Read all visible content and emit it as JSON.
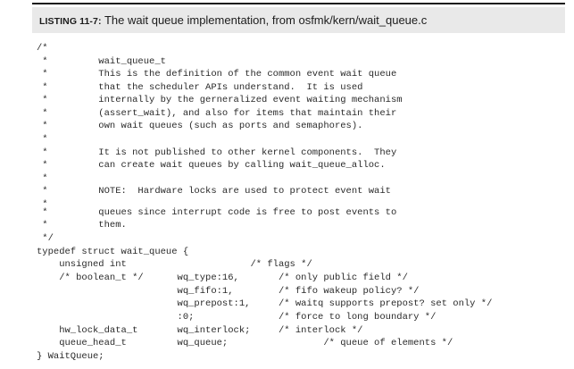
{
  "listing": {
    "label": "LISTING 11-7:",
    "title": "The wait queue implementation, from osfmk/kern/wait_queue.c"
  },
  "code_lines": [
    "/*",
    " *         wait_queue_t",
    " *         This is the definition of the common event wait queue",
    " *         that the scheduler APIs understand.  It is used",
    " *         internally by the gerneralized event waiting mechanism",
    " *         (assert_wait), and also for items that maintain their",
    " *         own wait queues (such as ports and semaphores).",
    " *",
    " *         It is not published to other kernel components.  They",
    " *         can create wait queues by calling wait_queue_alloc.",
    " *",
    " *         NOTE:  Hardware locks are used to protect event wait",
    " *",
    " *         queues since interrupt code is free to post events to",
    " *         them.",
    " */",
    "typedef struct wait_queue {",
    "    unsigned int                      /* flags */",
    "    /* boolean_t */      wq_type:16,       /* only public field */",
    "                         wq_fifo:1,        /* fifo wakeup policy? */",
    "                         wq_prepost:1,     /* waitq supports prepost? set only */",
    "                         :0;               /* force to long boundary */",
    "    hw_lock_data_t       wq_interlock;     /* interlock */",
    "    queue_head_t         wq_queue;                 /* queue of elements */",
    "} WaitQueue;"
  ]
}
